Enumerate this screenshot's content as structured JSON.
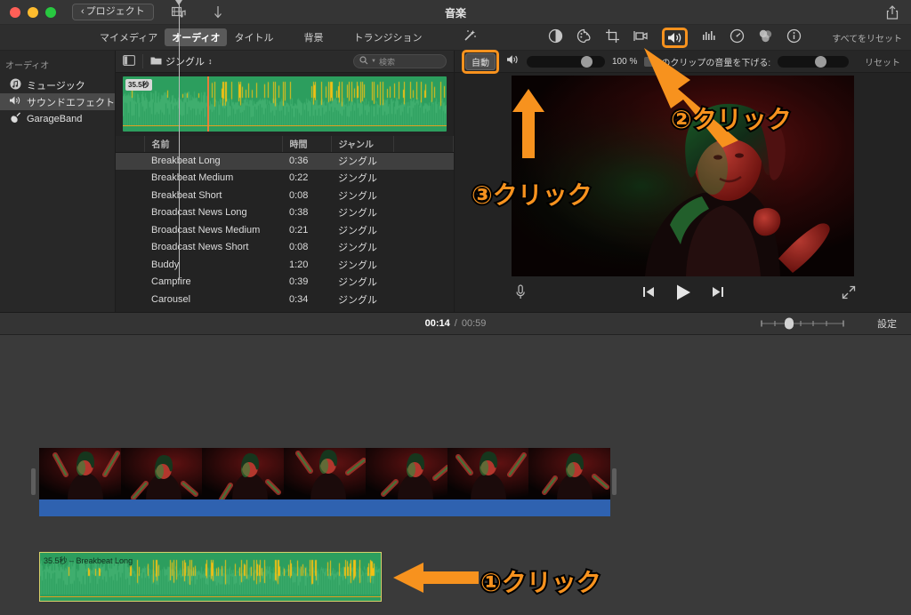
{
  "window": {
    "title": "音楽",
    "back_button": "プロジェクト",
    "film_music_icon": "film-music-icon",
    "download_icon": "download-arrow-icon",
    "share_icon": "share-icon"
  },
  "tabs": [
    {
      "label": "マイメディア",
      "active": false
    },
    {
      "label": "オーディオ",
      "active": true
    },
    {
      "label": "タイトル",
      "active": false
    },
    {
      "label": "背景",
      "active": false
    },
    {
      "label": "トランジション",
      "active": false
    }
  ],
  "adjust_toolbar": {
    "magic_icon": "magic-wand-icon",
    "reset_all": "すべてをリセット",
    "icons": [
      {
        "name": "color-balance-icon",
        "glyph": "◐",
        "active": false
      },
      {
        "name": "color-correction-icon",
        "glyph": "🎨",
        "active": false
      },
      {
        "name": "crop-icon",
        "glyph": "⌗",
        "active": false
      },
      {
        "name": "stabilization-icon",
        "glyph": "🎥",
        "active": false
      },
      {
        "name": "volume-icon",
        "glyph": "🔊",
        "active": true
      },
      {
        "name": "noise-reduction-icon",
        "glyph": "📶",
        "active": false
      },
      {
        "name": "speed-icon",
        "glyph": "◷",
        "active": false
      },
      {
        "name": "filters-icon",
        "glyph": "◍",
        "active": false
      },
      {
        "name": "info-icon",
        "glyph": "ⓘ",
        "active": false
      }
    ]
  },
  "sidebar": {
    "header": "オーディオ",
    "items": [
      {
        "label": "ミュージック",
        "icon": "music-note-icon",
        "glyph": "♫",
        "selected": false
      },
      {
        "label": "サウンドエフェクト",
        "icon": "speaker-icon",
        "glyph": "🔊",
        "selected": true
      },
      {
        "label": "GarageBand",
        "icon": "guitar-icon",
        "glyph": "🎸",
        "selected": false
      }
    ]
  },
  "browser": {
    "panel_toggle_icon": "sidebar-toggle-icon",
    "folder_icon": "folder-icon",
    "category": "ジングル",
    "category_chevron": "chevron-updown-icon",
    "search": {
      "icon": "search-icon",
      "placeholder": "検索",
      "value": ""
    },
    "preview": {
      "duration_badge": "35.5秒"
    },
    "columns": [
      "名前",
      "時間",
      "ジャンル"
    ],
    "rows": [
      {
        "name": "Breakbeat Long",
        "time": "0:36",
        "genre": "ジングル",
        "selected": true
      },
      {
        "name": "Breakbeat Medium",
        "time": "0:22",
        "genre": "ジングル",
        "selected": false
      },
      {
        "name": "Breakbeat Short",
        "time": "0:08",
        "genre": "ジングル",
        "selected": false
      },
      {
        "name": "Broadcast News Long",
        "time": "0:38",
        "genre": "ジングル",
        "selected": false
      },
      {
        "name": "Broadcast News Medium",
        "time": "0:21",
        "genre": "ジングル",
        "selected": false
      },
      {
        "name": "Broadcast News Short",
        "time": "0:08",
        "genre": "ジングル",
        "selected": false
      },
      {
        "name": "Buddy",
        "time": "1:20",
        "genre": "ジングル",
        "selected": false
      },
      {
        "name": "Campfire",
        "time": "0:39",
        "genre": "ジングル",
        "selected": false
      },
      {
        "name": "Carousel",
        "time": "0:34",
        "genre": "ジングル",
        "selected": false
      }
    ]
  },
  "inspector": {
    "auto_button": "自動",
    "speaker_icon": "speaker-icon",
    "volume_percent": "100 %",
    "volume_value": 100,
    "ducking_label": "のクリップの音量を下げる:",
    "ducking_value": 60,
    "reset": "リセット"
  },
  "player": {
    "voiceover_icon": "microphone-icon",
    "prev_icon": "skip-previous-icon",
    "play_icon": "play-icon",
    "next_icon": "skip-next-icon",
    "fullscreen_icon": "fullscreen-icon"
  },
  "timeline": {
    "current_time": "00:14",
    "separator": "/",
    "total_time": "00:59",
    "zoom_slider_icon": "zoom-slider",
    "settings": "設定",
    "audio_clip_label": "35.5秒 – Breakbeat Long"
  },
  "annotations": [
    {
      "id": "anno-1",
      "text": "①クリック",
      "arrow": "left-arrow"
    },
    {
      "id": "anno-2",
      "text": "②クリック",
      "arrow": "up-left-arrow"
    },
    {
      "id": "anno-3",
      "text": "③クリック",
      "arrow": "up-arrow"
    }
  ],
  "colors": {
    "accent": "#f7921e",
    "audio_clip": "#2c9e5e",
    "video_audio_bar": "#2f62b0",
    "selection": "#4a4a4a"
  }
}
